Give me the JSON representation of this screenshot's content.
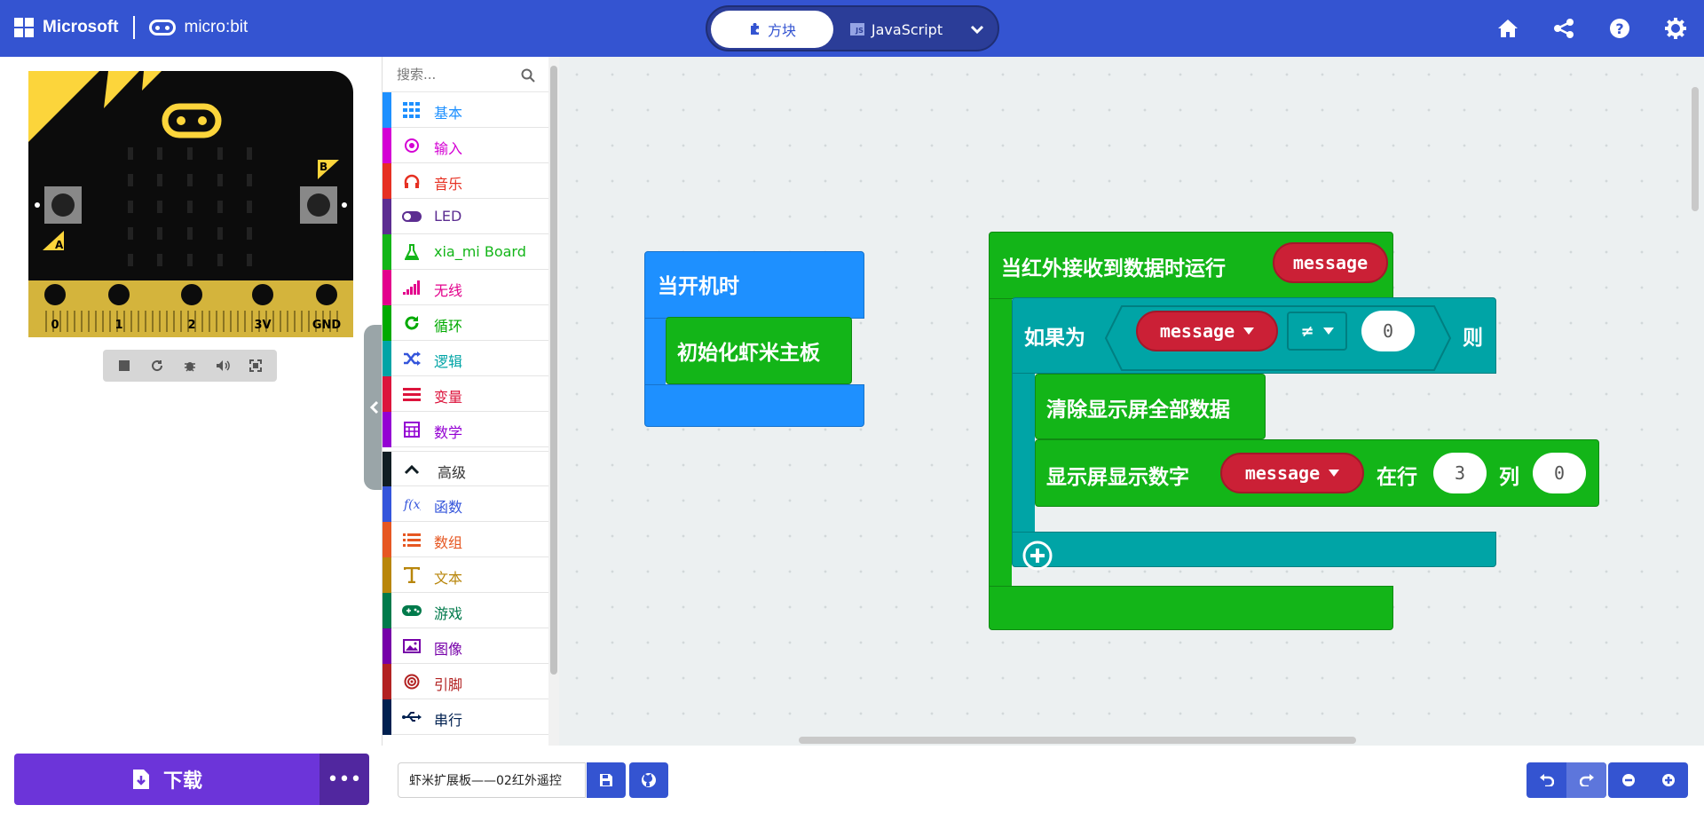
{
  "header": {
    "brand_microsoft": "Microsoft",
    "brand_product": "micro:bit",
    "tabs": [
      {
        "label": "方块",
        "active": true
      },
      {
        "label": "JavaScript",
        "active": false
      }
    ],
    "js_badge": "JS",
    "actions": [
      "home-icon",
      "share-icon",
      "help-icon",
      "settings-icon"
    ]
  },
  "simulator": {
    "pins": [
      "0",
      "1",
      "2",
      "3V",
      "GND"
    ],
    "button_a": "A",
    "button_b": "B",
    "controls": [
      "stop-icon",
      "restart-icon",
      "debug-icon",
      "mute-icon",
      "fullscreen-icon"
    ]
  },
  "toolbox": {
    "search_placeholder": "搜索...",
    "categories": [
      {
        "label": "基本",
        "color": "#1e90ff",
        "icon": "grid-icon"
      },
      {
        "label": "输入",
        "color": "#d400d4",
        "icon": "target-icon"
      },
      {
        "label": "音乐",
        "color": "#e63022",
        "icon": "headphones-icon"
      },
      {
        "label": "LED",
        "color": "#5c2d91",
        "icon": "toggle-icon"
      },
      {
        "label": "xia_mi Board",
        "color": "#13b518",
        "icon": "flask-icon"
      },
      {
        "label": "无线",
        "color": "#e3008c",
        "icon": "signal-icon"
      },
      {
        "label": "循环",
        "color": "#00aa00",
        "icon": "refresh-icon"
      },
      {
        "label": "逻辑",
        "color": "#00a4a6",
        "icon": "shuffle-icon"
      },
      {
        "label": "变量",
        "color": "#dc143c",
        "icon": "lines-icon"
      },
      {
        "label": "数学",
        "color": "#9400d3",
        "icon": "calculator-icon"
      },
      {
        "label": "高级",
        "color": "#101d23",
        "icon": "chevron-up-icon"
      },
      {
        "label": "函数",
        "color": "#3455db",
        "icon": "function-icon"
      },
      {
        "label": "数组",
        "color": "#e65722",
        "icon": "list-icon"
      },
      {
        "label": "文本",
        "color": "#b8860b",
        "icon": "text-icon"
      },
      {
        "label": "游戏",
        "color": "#007a4b",
        "icon": "gamepad-icon"
      },
      {
        "label": "图像",
        "color": "#7600a8",
        "icon": "image-icon"
      },
      {
        "label": "引脚",
        "color": "#b22222",
        "icon": "pin-icon"
      },
      {
        "label": "串行",
        "color": "#002050",
        "icon": "usb-icon"
      }
    ]
  },
  "workspace": {
    "on_start": {
      "label": "当开机时",
      "body": "初始化虾米主板"
    },
    "ir_event": {
      "label": "当红外接收到数据时运行",
      "param": "message",
      "if_label": "如果为",
      "then_label": "则",
      "condition": {
        "left": "message",
        "operator": "≠",
        "right": "0"
      },
      "clear_label": "清除显示屏全部数据",
      "show": {
        "label": "显示屏显示数字",
        "value": "message",
        "row_label": "在行",
        "row": "3",
        "col_label": "列",
        "col": "0"
      }
    }
  },
  "footer": {
    "download_label": "下载",
    "more_label": "•••",
    "project_name": "虾米扩展板——02红外遥控"
  },
  "colors": {
    "header": "#3454d1",
    "event_block": "#13b518",
    "start_block": "#1e90ff",
    "logic_block": "#00a4a6",
    "variable": "#cb2036",
    "download": "#6c34d9"
  }
}
